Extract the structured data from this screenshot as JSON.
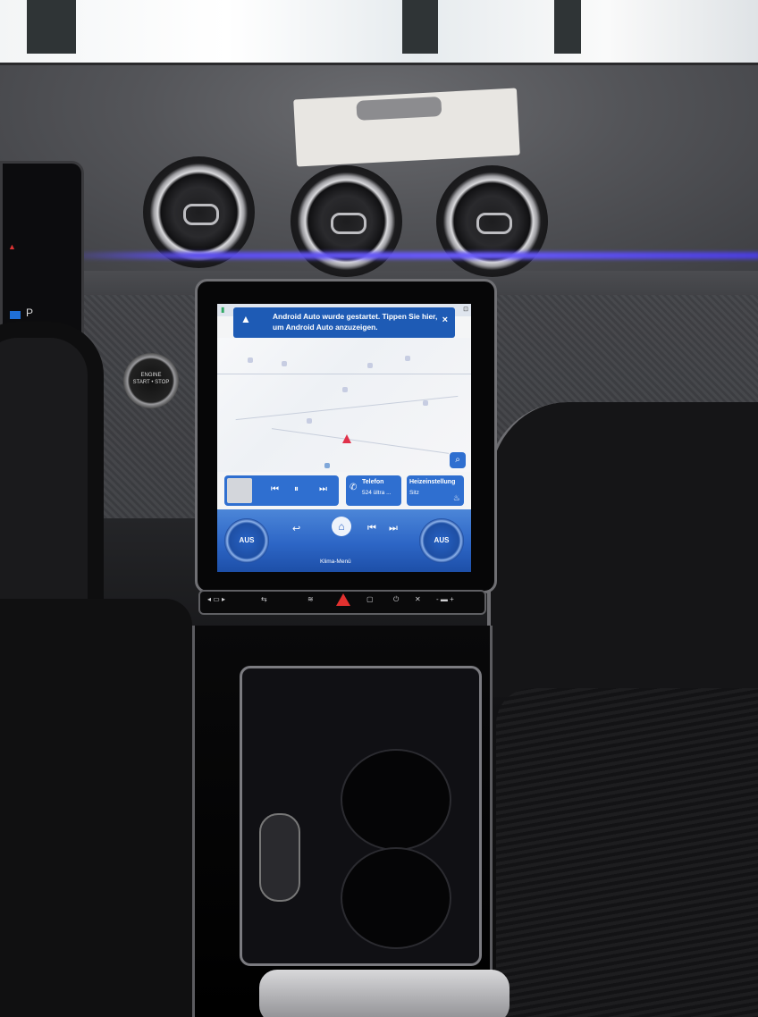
{
  "screen": {
    "notification": {
      "text": "Android Auto wurde gestartet. Tippen Sie hier, um Android Auto anzuzeigen.",
      "close": "×"
    },
    "widgets": {
      "phone_title": "Telefon",
      "phone_sub": "524 ültra ...",
      "heat_title": "Heizeinstellung",
      "heat_sub": "Sitz"
    },
    "climate": {
      "left_fan": "AUS",
      "right_fan": "AUS",
      "menu_label": "Klima-Menü"
    }
  },
  "dashboard": {
    "start_button_line1": "ENGINE",
    "start_button_line2": "START • STOP",
    "ambient_color": "#5b4df0",
    "screen_accent": "#2f6fd0",
    "hazard_color": "#e2312f"
  },
  "icons": [
    "navigation-arrow-icon",
    "close-icon",
    "phone-icon",
    "seat-heat-icon",
    "home-icon",
    "previous-track-icon",
    "next-track-icon",
    "play-pause-icon",
    "back-icon",
    "hazard-icon",
    "power-icon"
  ]
}
